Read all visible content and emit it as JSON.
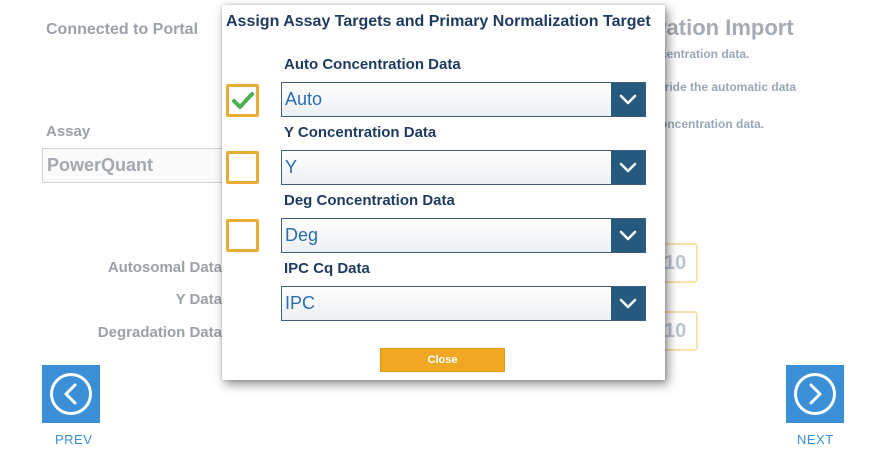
{
  "background": {
    "portal_status": "Connected to Portal",
    "title_fragment": "ration Import",
    "descriptions": [
      "centration data.",
      "rride the automatic data",
      "oncentration data."
    ],
    "assay_label": "Assay",
    "assay_value": "PowerQuant",
    "rows": [
      {
        "label": "Autosomal Data",
        "value": "10"
      },
      {
        "label": "Y Data"
      },
      {
        "label": "Degradation Data",
        "value": "10"
      }
    ]
  },
  "navigation": {
    "prev_label": "PREV",
    "next_label": "NEXT"
  },
  "modal": {
    "title": "Assign Assay Targets and Primary Normalization Target",
    "fields": [
      {
        "label": "Auto Concentration Data",
        "value": "Auto",
        "checked": true
      },
      {
        "label": "Y Concentration Data",
        "value": "Y",
        "checked": false
      },
      {
        "label": "Deg Concentration Data",
        "value": "Deg",
        "checked": false
      },
      {
        "label": "IPC Cq Data",
        "value": "IPC"
      }
    ],
    "close_label": "Close"
  },
  "icons": {
    "check": "checkmark-icon",
    "dropdown": "chevron-down-icon",
    "prev": "chevron-left-icon",
    "next": "chevron-right-icon"
  },
  "colors": {
    "accent_blue": "#3a8fd6",
    "dropdown_dark": "#255a7e",
    "checkbox_border": "#e9ad35",
    "check_green": "#4caf50",
    "close_button": "#f0a824",
    "heading": "#1e3a5f"
  }
}
